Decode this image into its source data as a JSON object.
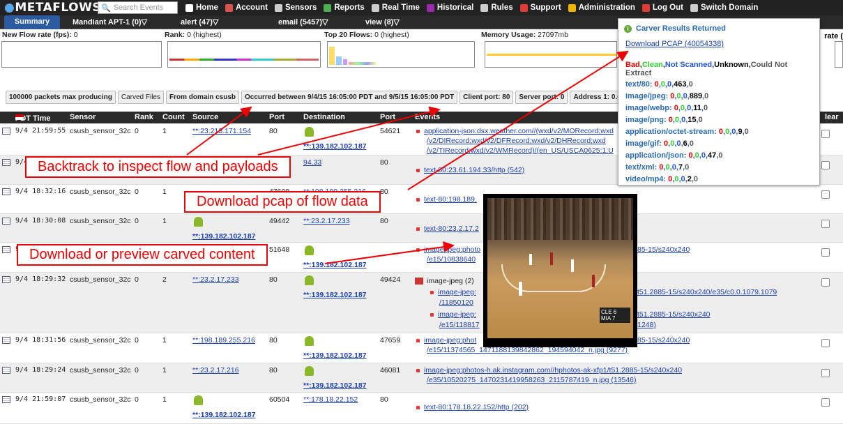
{
  "topnav": {
    "logo": "METAFLOWS",
    "search_placeholder": "Search Events",
    "items": [
      {
        "label": "Home",
        "icon": "home-icon",
        "color": "#ffffff"
      },
      {
        "label": "Account",
        "icon": "user-icon",
        "color": "#d9534f"
      },
      {
        "label": "Sensors",
        "icon": "sensor-icon",
        "color": "#cccccc"
      },
      {
        "label": "Reports",
        "icon": "pie-chart-icon",
        "color": "#4caf50"
      },
      {
        "label": "Real Time",
        "icon": "realtime-icon",
        "color": "#cccccc"
      },
      {
        "label": "Historical",
        "icon": "historical-icon",
        "color": "#9c27b0"
      },
      {
        "label": "Rules",
        "icon": "rules-icon",
        "color": "#cccccc"
      },
      {
        "label": "Support",
        "icon": "support-icon",
        "color": "#e53935"
      },
      {
        "label": "Administration",
        "icon": "crown-icon",
        "color": "#f0b400"
      },
      {
        "label": "Log Out",
        "icon": "logout-icon",
        "color": "#e53935"
      },
      {
        "label": "Switch Domain",
        "icon": "switch-icon",
        "color": "#cccccc"
      }
    ]
  },
  "tabs": {
    "summary": "Summary",
    "mandiant": "Mandiant APT-1 (0)▽",
    "alert": "alert (47)▽",
    "email": "email (5457)▽",
    "view": "view (8)▽",
    "rate": "rate ("
  },
  "stats": {
    "flow_label": "New Flow rate (fps):",
    "flow_value": "0",
    "rank_label": "Rank:",
    "rank_value": "0 (highest)",
    "top_label": "Top 20 Flows:",
    "top_value": "0 (highest)",
    "mem_label": "Memory Usage:",
    "mem_value": "27097mb"
  },
  "filters": [
    {
      "label": "100000 packets max producing",
      "bold": true
    },
    {
      "label": "Carved Files",
      "bold": false
    },
    {
      "label": "From domain csusb",
      "bold": true
    },
    {
      "label": "Occurred between 9/4/15 16:05:00 PDT and 9/5/15 16:05:00 PDT",
      "bold": true
    },
    {
      "label": "Client port: 80",
      "bold": true
    },
    {
      "label": "Server port: 0",
      "bold": true
    },
    {
      "label": "Address 1: 0.0.0.0",
      "bold": true
    },
    {
      "label": "Address 2:",
      "bold": true
    }
  ],
  "table": {
    "headers": {
      "time": "PDT Time",
      "sensor": "Sensor",
      "rank": "Rank",
      "count": "Count",
      "source": "Source",
      "port": "Port",
      "destination": "Destination",
      "port2": "Port",
      "events": "Events",
      "clear": "lear"
    },
    "rows": [
      {
        "time": "9/4 21:59:55",
        "sensor": "csusb_sensor_32c",
        "rank": "0",
        "count": "1",
        "source": "**:23.213.171.154",
        "sport": "80",
        "dest": "**:139.182.102.187",
        "dport": "54621",
        "ev1": "application-json:dsx.weather.com//(wxd/v2/MORecord;wxd",
        "ev2": "/v2/DIRecord;wxd/v2/DFRecord;wxd/v2/DHRecord;wxd",
        "ev3": "/v2/TIRecord;wxd/v2/WMRecord)/(en_US/USCA0625:1:U"
      },
      {
        "time": "9/4",
        "dest": "94.33",
        "dport": "80",
        "ev1": "text-80:23.61.194.33/http (542)"
      },
      {
        "time": "9/4 18:32:16",
        "sensor": "csusb_sensor_32c",
        "rank": "0",
        "count": "1",
        "sport": "47608",
        "dest": "**:198.189.255.216",
        "dport": "80",
        "ev1": "text-80:198.189."
      },
      {
        "time": "9/4 18:30:08",
        "sensor": "csusb_sensor_32c",
        "rank": "0",
        "count": "1",
        "source": "**:139.182.102.187",
        "sport": "49442",
        "dest": "**:23.2.17.233",
        "dport": "80",
        "ev1": "text-80:23.2.17.2"
      },
      {
        "time": "9/4",
        "sport": "51648",
        "dest": "**:139.182.102.187",
        "ev1": "image-jpeg:photo",
        "ev1b": "85-15/s240x240",
        "ev2": "/e15/10838640"
      },
      {
        "time": "9/4 18:29:32",
        "sensor": "csusb_sensor_32c",
        "rank": "0",
        "count": "2",
        "source": "**:23.2.17.233",
        "sport": "80",
        "dest": "**:139.182.102.187",
        "dport": "49424",
        "evh": "image-jpeg (2)",
        "ev1": "image-jpeg:",
        "ev1b": "t51.2885-15/s240x240/e35/c0.0.1079.1079",
        "ev2": "/11850120",
        "ev3": "image-jpeg:",
        "ev3b": "t51.2885-15/s240x240",
        "ev4": "/e15/118817",
        "ev4b": "1248)"
      },
      {
        "time": "9/4 18:31:56",
        "sensor": "csusb_sensor_32c",
        "rank": "0",
        "count": "1",
        "source": "**:198.189.255.216",
        "sport": "80",
        "dest": "**:139.182.102.187",
        "dport": "47659",
        "ev1": "image-jpeg:phot",
        "ev1b": "85-15/s240x240",
        "ev2": "/e15/11374565_1471188139842862_194594042_n.jpg (9277)"
      },
      {
        "time": "9/4 18:29:24",
        "sensor": "csusb_sensor_32c",
        "rank": "0",
        "count": "1",
        "source": "**:23.2.17.216",
        "sport": "80",
        "dest": "**:139.182.102.187",
        "dport": "46081",
        "ev1": "image-jpeg:photos-h.ak.instagram.com//hphotos-ak-xfp1/t51.2885-15/s240x240",
        "ev2": "/e35/10520275_1470231419958263_2115787419_n.jpg (13546)"
      },
      {
        "time": "9/4 21:59:07",
        "sensor": "csusb_sensor_32c",
        "rank": "0",
        "count": "1",
        "source": "**:139.182.102.187",
        "sport": "60504",
        "dest": "**:178.18.22.152",
        "dport": "80",
        "ev1": "text-80:178.18.22.152/http (202)"
      }
    ]
  },
  "popup": {
    "title": "Carver Results Returned",
    "download": "Download PCAP (40054338)",
    "legend": {
      "bad": "Bad",
      "clean": "Clean",
      "not_scanned": "Not Scanned",
      "unknown": "Unknown",
      "could_not": "Could Not Extract"
    },
    "types": [
      {
        "name": "text/80:",
        "b": "0",
        "c": "0",
        "n": "0",
        "u": "463",
        "x": "0"
      },
      {
        "name": "image/jpeg:",
        "b": "0",
        "c": "0",
        "n": "0",
        "u": "889",
        "x": "0"
      },
      {
        "name": "image/webp:",
        "b": "0",
        "c": "0",
        "n": "0",
        "u": "11",
        "x": "0"
      },
      {
        "name": "image/png:",
        "b": "0",
        "c": "0",
        "n": "0",
        "u": "15",
        "x": "0"
      },
      {
        "name": "application/octet-stream:",
        "b": "0",
        "c": "0",
        "n": "0",
        "u": "9",
        "x": "0"
      },
      {
        "name": "image/gif:",
        "b": "0",
        "c": "0",
        "n": "0",
        "u": "6",
        "x": "0"
      },
      {
        "name": "application/json:",
        "b": "0",
        "c": "0",
        "n": "0",
        "u": "47",
        "x": "0"
      },
      {
        "name": "text/xml:",
        "b": "0",
        "c": "0",
        "n": "0",
        "u": "7",
        "x": "0"
      },
      {
        "name": "video/mp4:",
        "b": "0",
        "c": "0",
        "n": "0",
        "u": "2",
        "x": "0"
      }
    ],
    "colors": {
      "bad": "#e00000",
      "clean": "#33cc33",
      "not_scanned": "#2255dd",
      "unknown": "#000000",
      "could_not": "#555555"
    }
  },
  "callouts": {
    "backtrack": "Backtrack to inspect flow and payloads",
    "download": "Download pcap of flow data",
    "preview": "Download or preview carved content"
  }
}
